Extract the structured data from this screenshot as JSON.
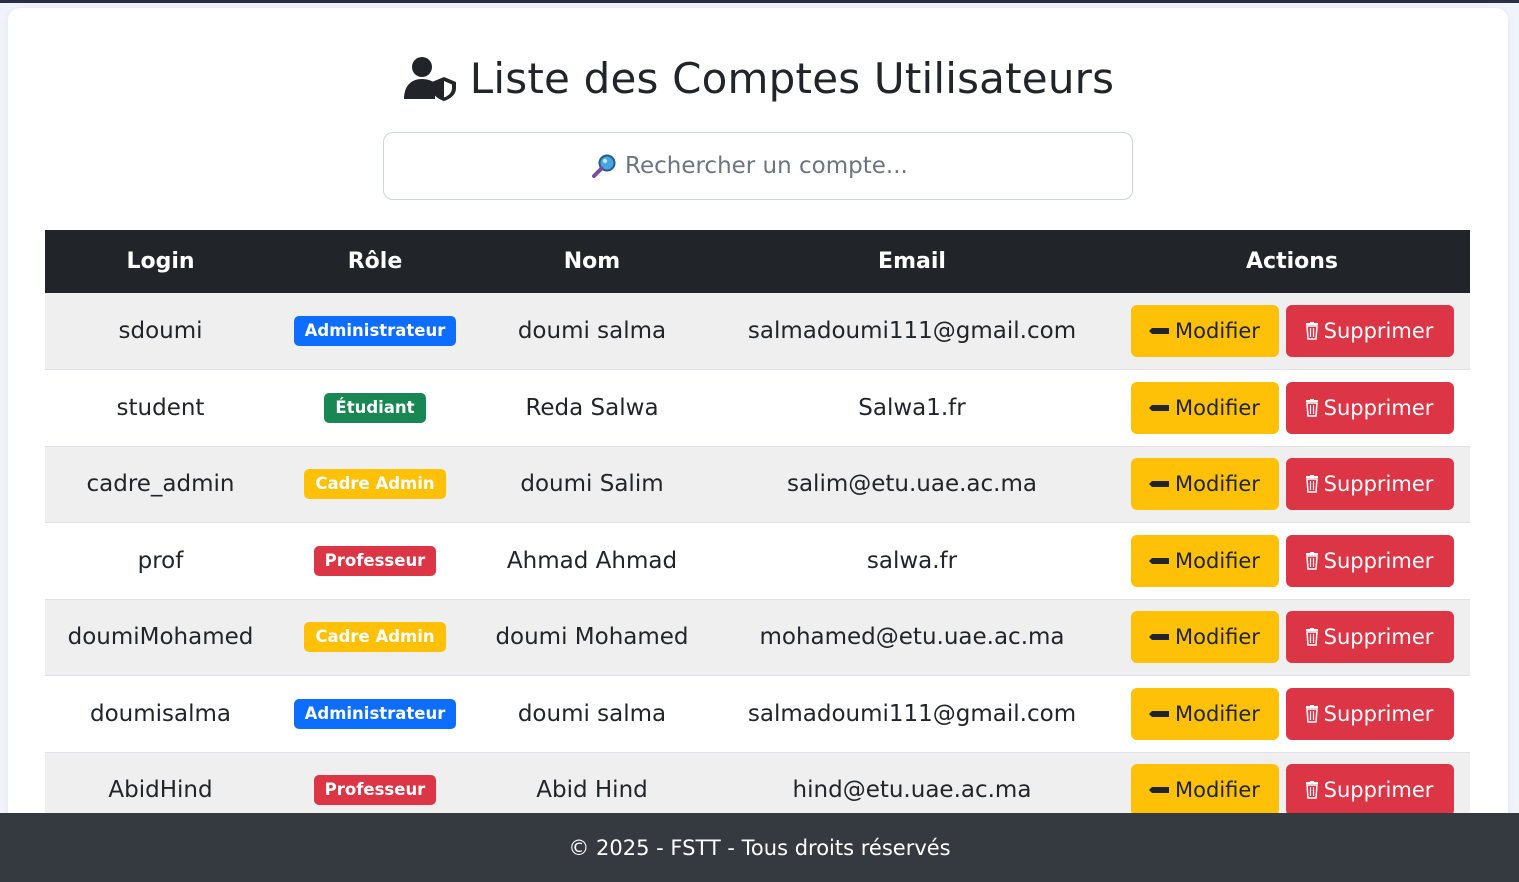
{
  "header": {
    "title": "Liste des Comptes Utilisateurs",
    "title_icon": "user-shield-icon"
  },
  "search": {
    "placeholder": "Rechercher un compte...",
    "icon": "magnifier-icon"
  },
  "table": {
    "columns": [
      "Login",
      "Rôle",
      "Nom",
      "Email",
      "Actions"
    ],
    "rows": [
      {
        "login": "sdoumi",
        "role": "Administrateur",
        "role_color": "#0d6efd",
        "nom": "doumi salma",
        "email": "salmadoumi111@gmail.com"
      },
      {
        "login": "student",
        "role": "Étudiant",
        "role_color": "#198754",
        "nom": "Reda Salwa",
        "email": "Salwa1.fr"
      },
      {
        "login": "cadre_admin",
        "role": "Cadre Admin",
        "role_color": "#ffc107",
        "nom": "doumi Salim",
        "email": "salim@etu.uae.ac.ma"
      },
      {
        "login": "prof",
        "role": "Professeur",
        "role_color": "#dc3545",
        "nom": "Ahmad Ahmad",
        "email": "salwa.fr"
      },
      {
        "login": "doumiMohamed",
        "role": "Cadre Admin",
        "role_color": "#ffc107",
        "nom": "doumi Mohamed",
        "email": "mohamed@etu.uae.ac.ma"
      },
      {
        "login": "doumisalma",
        "role": "Administrateur",
        "role_color": "#0d6efd",
        "nom": "doumi salma",
        "email": "salmadoumi111@gmail.com"
      },
      {
        "login": "AbidHind",
        "role": "Professeur",
        "role_color": "#dc3545",
        "nom": "Abid Hind",
        "email": "hind@etu.uae.ac.ma"
      }
    ],
    "actions": {
      "edit_label": "Modifier",
      "edit_icon": "pen-icon",
      "delete_label": "Supprimer",
      "delete_icon": "trash-icon"
    }
  },
  "footer": {
    "text": "© 2025 - FSTT - Tous droits réservés"
  },
  "colors": {
    "warning": "#ffc107",
    "danger": "#dc3545",
    "primary": "#0d6efd",
    "success": "#198754",
    "dark": "#212529"
  }
}
